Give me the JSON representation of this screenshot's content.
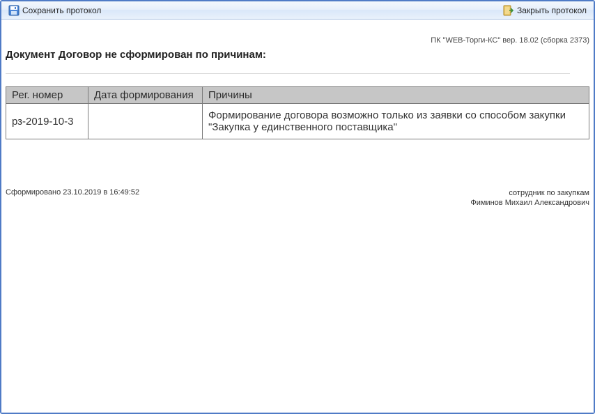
{
  "toolbar": {
    "save_label": "Сохранить протокол",
    "close_label": "Закрыть протокол"
  },
  "app_info": "ПК \"WEB-Торги-КС\" вер. 18.02 (сборка 2373)",
  "doc_title": "Документ Договор не сформирован по причинам:",
  "table": {
    "headers": {
      "reg": "Рег. номер",
      "date": "Дата формирования",
      "reason": "Причины"
    },
    "rows": [
      {
        "reg": "рз-2019-10-3",
        "date": "",
        "reason": " Формирование договора возможно только из заявки со способом закупки \"Закупка у единственного поставщика\""
      }
    ]
  },
  "footer": {
    "generated": "Сформировано 23.10.2019 в 16:49:52",
    "role": "сотрудник по закупкам",
    "user": "Фиминов Михаил Александрович"
  }
}
